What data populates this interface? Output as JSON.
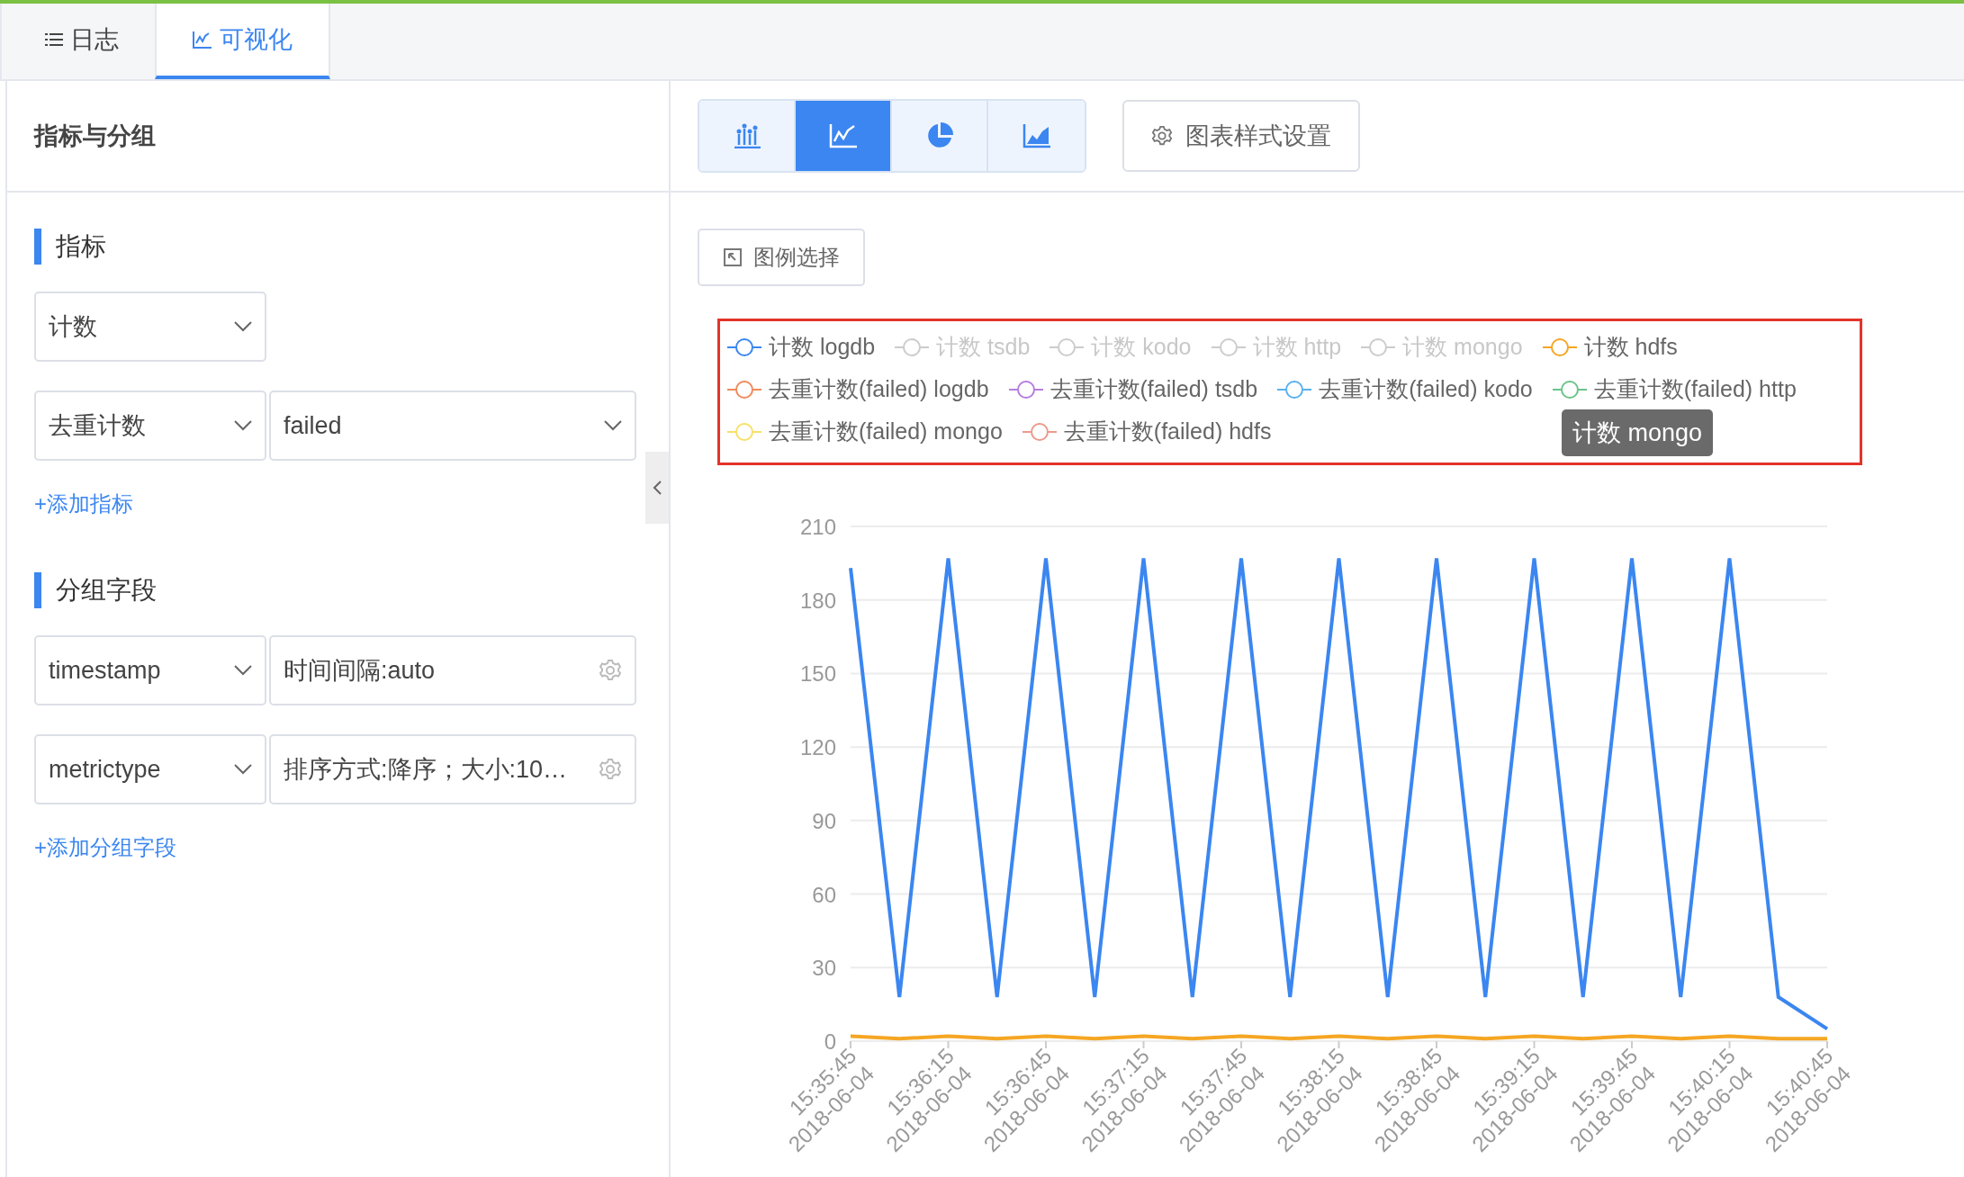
{
  "tabs": [
    {
      "label": "日志",
      "selected": false
    },
    {
      "label": "可视化",
      "selected": true
    }
  ],
  "left_panel": {
    "title": "指标与分组",
    "metrics": {
      "title": "指标",
      "rows": [
        {
          "fields": [
            {
              "value": "计数",
              "kind": "select"
            }
          ]
        },
        {
          "fields": [
            {
              "value": "去重计数",
              "kind": "select"
            },
            {
              "value": "failed",
              "kind": "select"
            }
          ]
        }
      ],
      "add_link": "+添加指标"
    },
    "groups": {
      "title": "分组字段",
      "rows": [
        {
          "fields": [
            {
              "value": "timestamp",
              "kind": "select"
            },
            {
              "value": "时间间隔:auto",
              "kind": "setting"
            }
          ]
        },
        {
          "fields": [
            {
              "value": "metrictype",
              "kind": "select"
            },
            {
              "value": "排序方式:降序；大小:10…",
              "kind": "setting"
            }
          ]
        }
      ],
      "add_link": "+添加分组字段"
    }
  },
  "chart_types": [
    {
      "kind": "bar",
      "selected": false
    },
    {
      "kind": "line",
      "selected": true
    },
    {
      "kind": "pie",
      "selected": false
    },
    {
      "kind": "area",
      "selected": false
    }
  ],
  "style_button": "图表样式设置",
  "legend_button": "图例选择",
  "legend": [
    {
      "label": "计数 logdb",
      "color": "#3b86f0",
      "selected": true
    },
    {
      "label": "计数 tsdb",
      "selected": false
    },
    {
      "label": "计数 kodo",
      "selected": false
    },
    {
      "label": "计数 http",
      "selected": false
    },
    {
      "label": "计数 mongo",
      "selected": false
    },
    {
      "label": "计数 hdfs",
      "color": "#f5a623",
      "selected": true
    },
    {
      "label": "去重计数(failed) logdb",
      "color": "#f08a5d",
      "selected": true
    },
    {
      "label": "去重计数(failed) tsdb",
      "color": "#b57ee0",
      "selected": true
    },
    {
      "label": "去重计数(failed) kodo",
      "color": "#5ab1ef",
      "selected": true
    },
    {
      "label": "去重计数(failed) http",
      "color": "#6cc48a",
      "selected": true
    },
    {
      "label": "去重计数(failed) mongo",
      "color": "#f7e06a",
      "selected": true
    },
    {
      "label": "去重计数(failed) hdfs",
      "color": "#ec9a8c",
      "selected": true
    }
  ],
  "tooltip": "计数 mongo",
  "chart_data": {
    "type": "line",
    "grid": true,
    "categories": [
      "15:35:45 2018-06-04",
      null,
      "15:36:15 2018-06-04",
      null,
      "15:36:45 2018-06-04",
      null,
      "15:37:15 2018-06-04",
      null,
      "15:37:45 2018-06-04",
      null,
      "15:38:15 2018-06-04",
      null,
      "15:38:45 2018-06-04",
      null,
      "15:39:15 2018-06-04",
      null,
      "15:39:45 2018-06-04",
      null,
      "15:40:15 2018-06-04",
      null,
      "15:40:45 2018-06-04"
    ],
    "series": [
      {
        "color": "#3b86f0",
        "values": [
          193,
          18,
          197,
          18,
          197,
          18,
          197,
          18,
          197,
          18,
          197,
          18,
          197,
          18,
          197,
          18,
          197,
          18,
          197,
          18,
          5
        ]
      },
      {
        "color": "#f5a623",
        "values": [
          2,
          1,
          2,
          1,
          2,
          1,
          2,
          1,
          2,
          1,
          2,
          1,
          2,
          1,
          2,
          1,
          2,
          1,
          2,
          1,
          1
        ]
      }
    ],
    "ylim": [
      0,
      210
    ],
    "yticks": [
      0,
      30,
      60,
      90,
      120,
      150,
      180,
      210
    ]
  }
}
